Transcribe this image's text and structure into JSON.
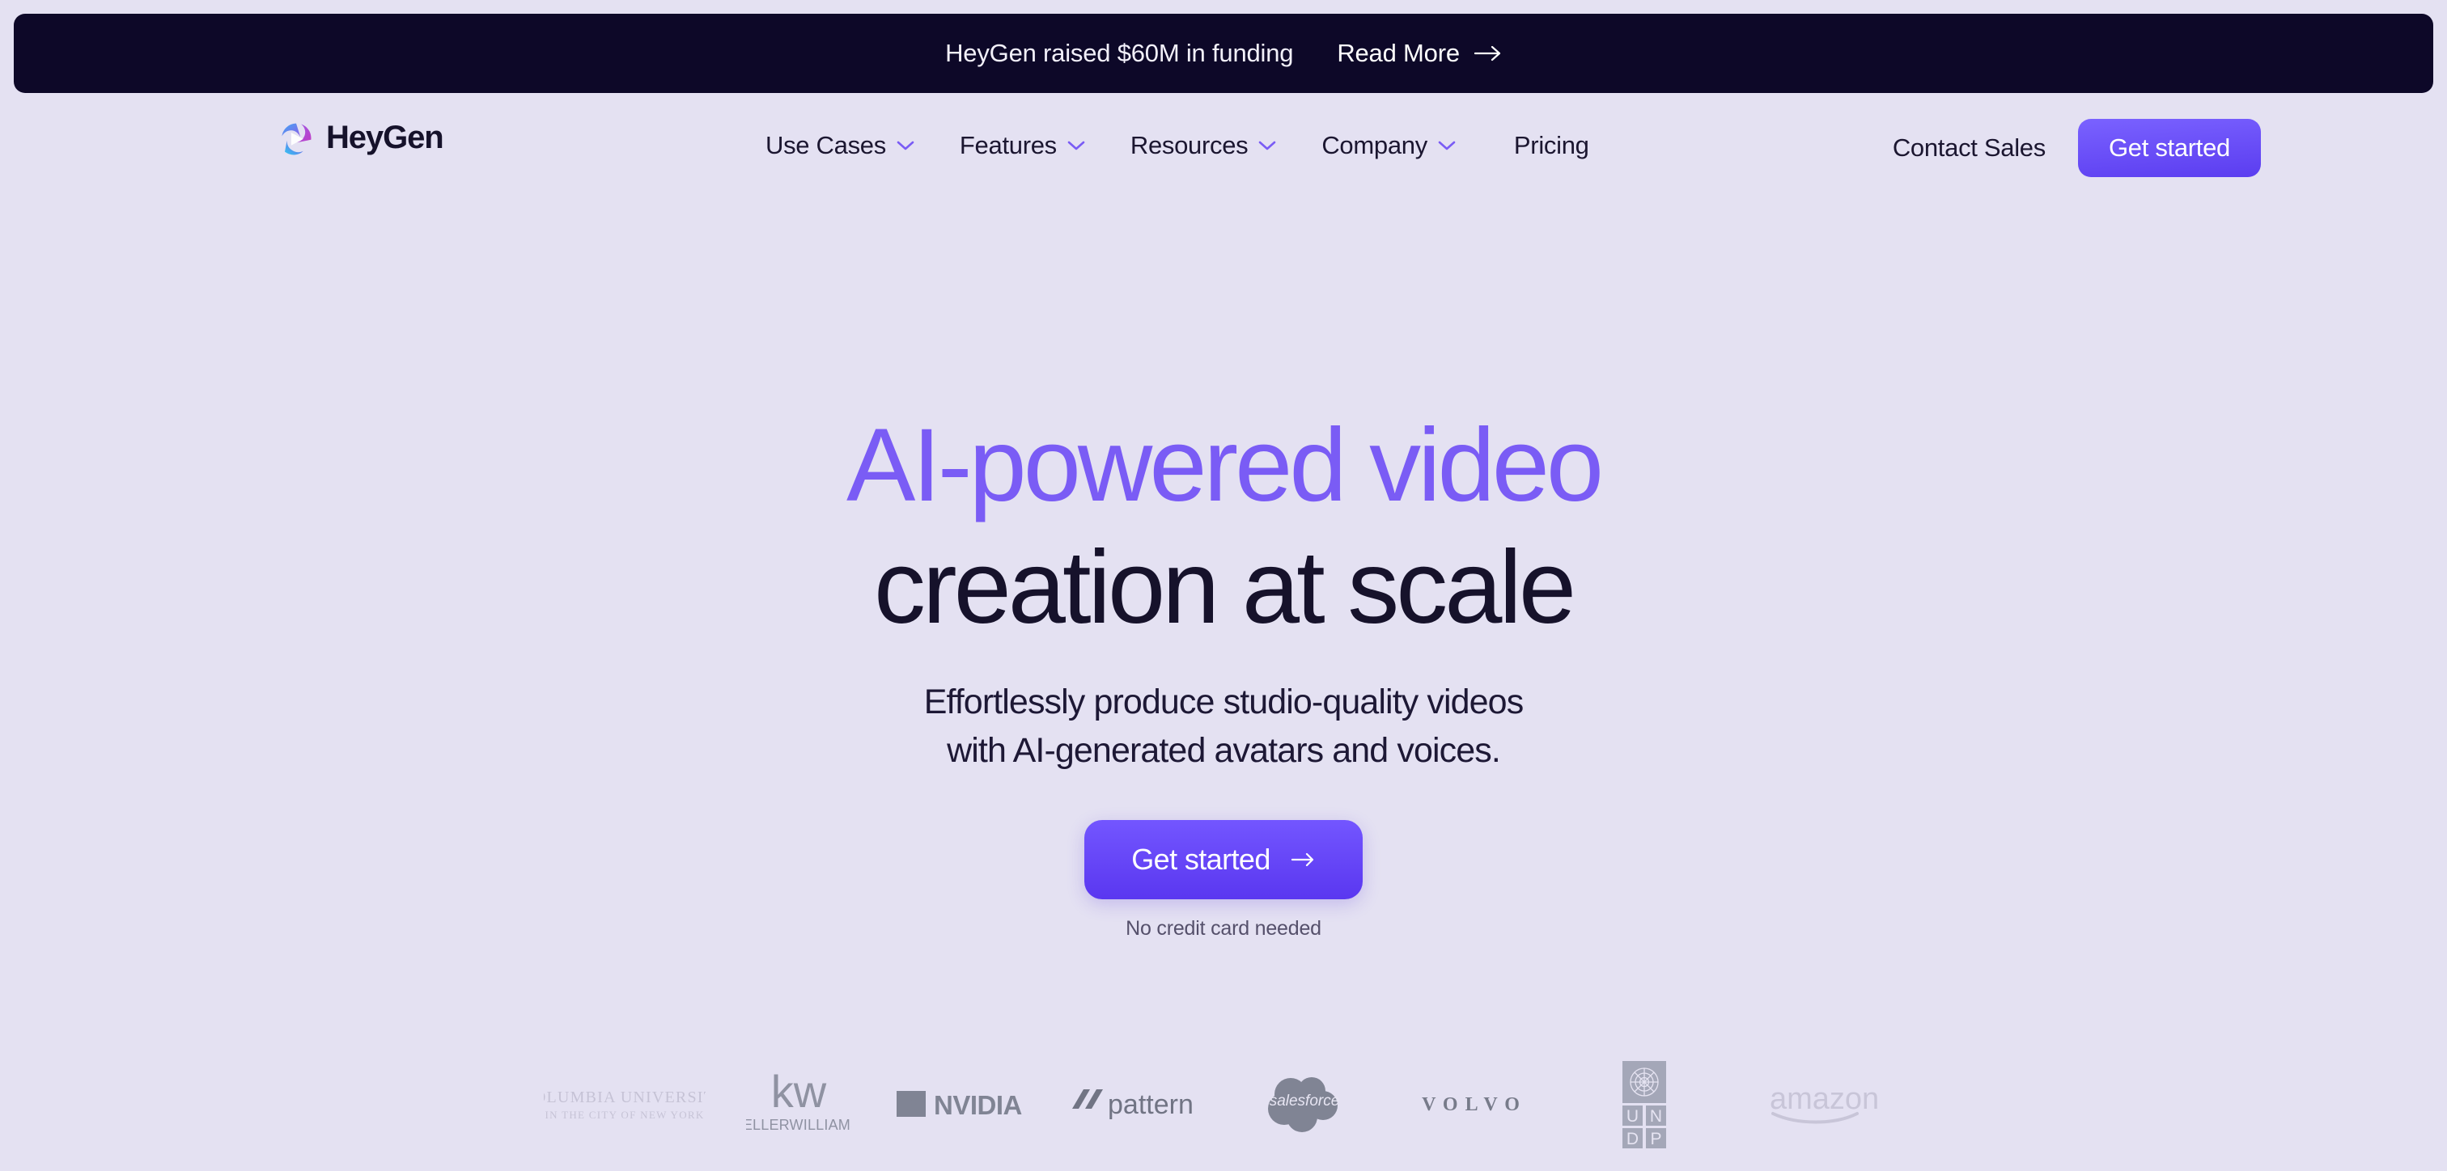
{
  "theme": {
    "page_bg": "#E4E1F2",
    "banner_bg": "#0D0828",
    "accent_purple": "#7A5CF5",
    "button_gradient_from": "#7A62FF",
    "button_gradient_to": "#5B3DF0",
    "heading_dark": "#16122B",
    "logo_gray": "#6F7484"
  },
  "banner": {
    "text": "HeyGen raised $60M in funding",
    "link_label": "Read More",
    "arrow_icon": "arrow-right-icon"
  },
  "header": {
    "logo": {
      "icon": "heygen-swirl-logo-icon",
      "text": "HeyGen"
    },
    "nav_items": [
      {
        "label": "Use Cases",
        "icon": "chevron-down-icon",
        "has_dropdown": true
      },
      {
        "label": "Features",
        "icon": "chevron-down-icon",
        "has_dropdown": true
      },
      {
        "label": "Resources",
        "icon": "chevron-down-icon",
        "has_dropdown": true
      },
      {
        "label": "Company",
        "icon": "chevron-down-icon",
        "has_dropdown": true
      },
      {
        "label": "Pricing",
        "icon": "",
        "has_dropdown": false
      }
    ],
    "contact_sales_label": "Contact Sales",
    "get_started_label": "Get started"
  },
  "hero": {
    "headline_line1": "AI-powered video",
    "headline_line2": "creation at scale",
    "subheadline_line1": "Effortlessly produce studio-quality videos",
    "subheadline_line2": "with AI-generated avatars and voices.",
    "cta_label": "Get started",
    "cta_icon": "arrow-right-icon",
    "cta_note": "No credit card needed"
  },
  "logo_strip": {
    "logos": [
      {
        "name": "columbia-university-logo",
        "label": "COLUMBIA UNIVERSITY",
        "sublabel": "IN THE CITY OF NEW YORK",
        "opacity": 0.18
      },
      {
        "name": "keller-williams-logo",
        "label": "kw",
        "sublabel": "KELLERWILLIAMS.",
        "opacity": 0.75
      },
      {
        "name": "nvidia-logo",
        "label": "NVIDIA",
        "sublabel": "",
        "opacity": 0.85
      },
      {
        "name": "pattern-logo",
        "label": "pattern",
        "sublabel": "",
        "opacity": 0.85
      },
      {
        "name": "salesforce-logo",
        "label": "salesforce",
        "sublabel": "",
        "opacity": 0.85
      },
      {
        "name": "volvo-logo",
        "label": "VOLVO",
        "sublabel": "",
        "opacity": 0.8
      },
      {
        "name": "undp-logo",
        "label": "UNDP",
        "sublabel": "",
        "opacity": 0.7
      },
      {
        "name": "amazon-logo",
        "label": "amazon",
        "sublabel": "",
        "opacity": 0.16
      }
    ]
  }
}
